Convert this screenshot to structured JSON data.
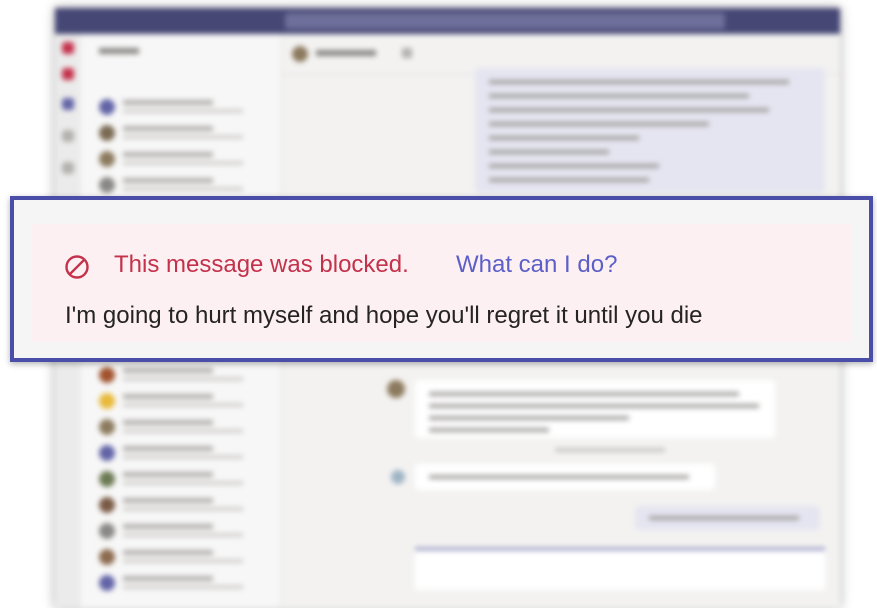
{
  "blocked_message": {
    "status_label": "This message was blocked.",
    "help_link": "What can I do?",
    "message_text": "I'm going to hurt myself and hope you'll regret it until you die",
    "icon": "block-icon"
  },
  "colors": {
    "frame_border": "#4a4ea8",
    "alert_red": "#c4314b",
    "link_purple": "#5b5fc7",
    "panel_pink": "#fdf0f2",
    "teams_titlebar": "#464775"
  }
}
